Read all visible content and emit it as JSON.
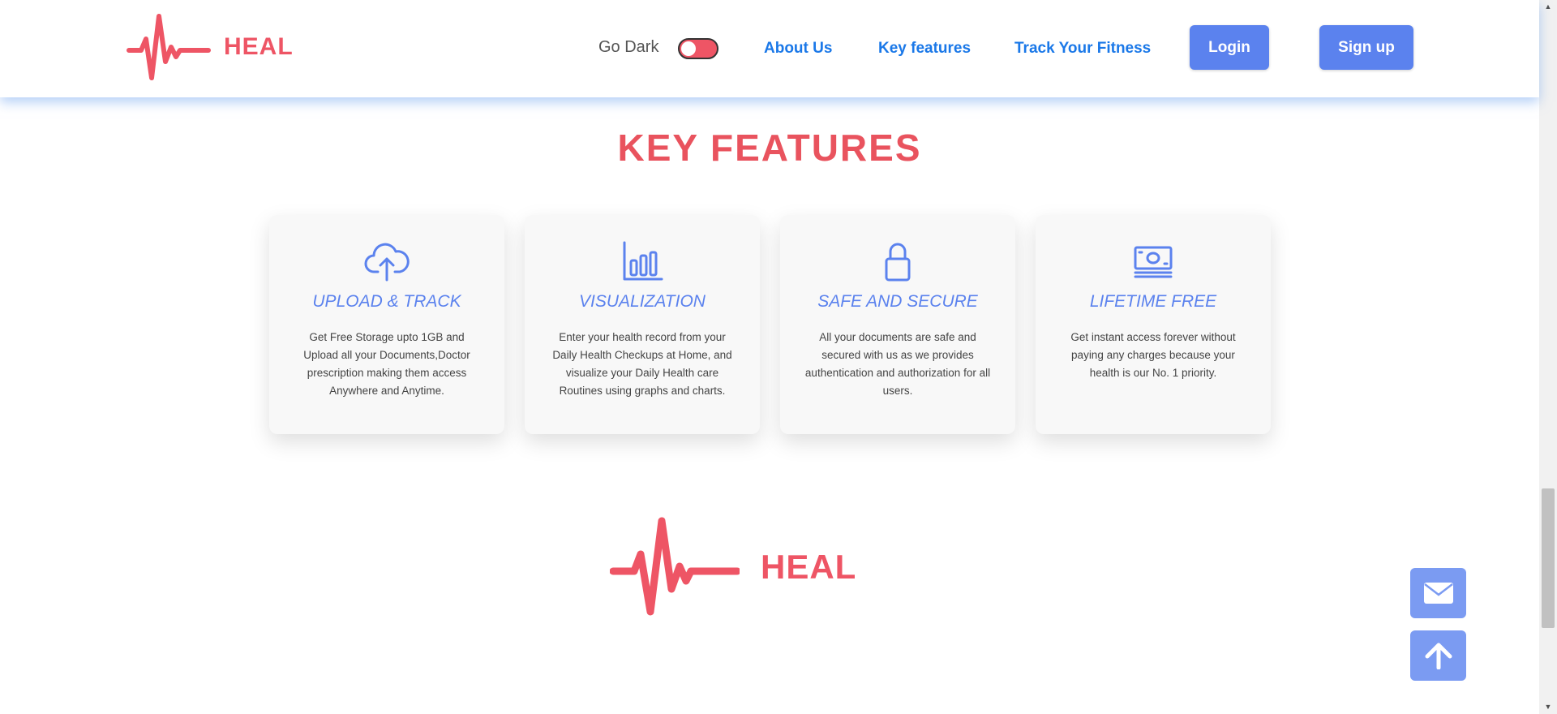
{
  "header": {
    "logo_text": "HEAL",
    "dark_mode_label": "Go Dark",
    "nav": {
      "about": "About Us",
      "features": "Key features",
      "fitness": "Track Your Fitness"
    },
    "login_label": "Login",
    "signup_label": "Sign up"
  },
  "section": {
    "title": "KEY FEATURES",
    "cards": [
      {
        "icon": "cloud-upload-icon",
        "title": "UPLOAD & TRACK",
        "desc": "Get Free Storage upto 1GB and Upload all your Documents,Doctor prescription making them access Anywhere and Anytime."
      },
      {
        "icon": "bar-chart-icon",
        "title": "VISUALIZATION",
        "desc": "Enter your health record from your Daily Health Checkups at Home, and visualize your Daily Health care Routines using graphs and charts."
      },
      {
        "icon": "lock-icon",
        "title": "SAFE AND SECURE",
        "desc": "All your documents are safe and secured with us as we provides authentication and authorization for all users."
      },
      {
        "icon": "money-icon",
        "title": "LIFETIME FREE",
        "desc": "Get instant access forever without paying any charges because your health is our No. 1 priority."
      }
    ]
  },
  "footer": {
    "logo_text": "HEAL"
  },
  "floating": {
    "mail_icon": "mail-icon",
    "up_icon": "arrow-up-icon"
  },
  "colors": {
    "brand": "#ee5565",
    "accent": "#5b82ee",
    "link": "#1a78e8"
  }
}
